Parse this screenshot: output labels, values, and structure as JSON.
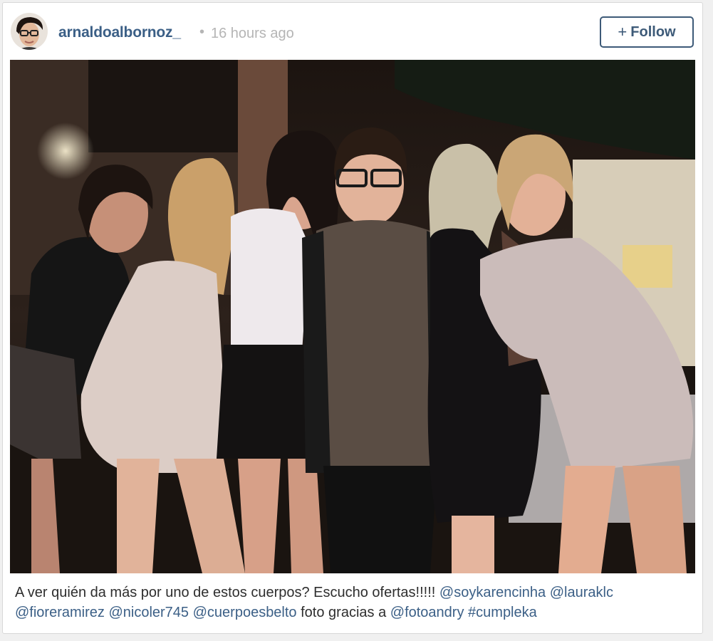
{
  "post": {
    "username": "arnaldoalbornoz_",
    "separator": "•",
    "timestamp": "16 hours ago",
    "follow_button": {
      "plus": "+",
      "label": "Follow"
    },
    "photo_alt": "",
    "caption": {
      "text": "A ver quién da más por uno de estos cuerpos? Escucho ofertas!!!!!",
      "mention_1": "@soykarencinha",
      "mention_2": "@lauraklc",
      "mention_3": "@fioreramirez",
      "mention_4": "@nicoler745",
      "mention_5": "@cuerpoesbelto",
      "text_2": "foto gracias a",
      "mention_6": "@fotoandry",
      "hashtag": "#cumpleka"
    }
  },
  "colors": {
    "link": "#3b5f86",
    "follow_border": "#3d5a78",
    "muted": "#b5b5b5",
    "text": "#2e2e2e"
  },
  "icons": {
    "avatar": "user-avatar-photo"
  }
}
